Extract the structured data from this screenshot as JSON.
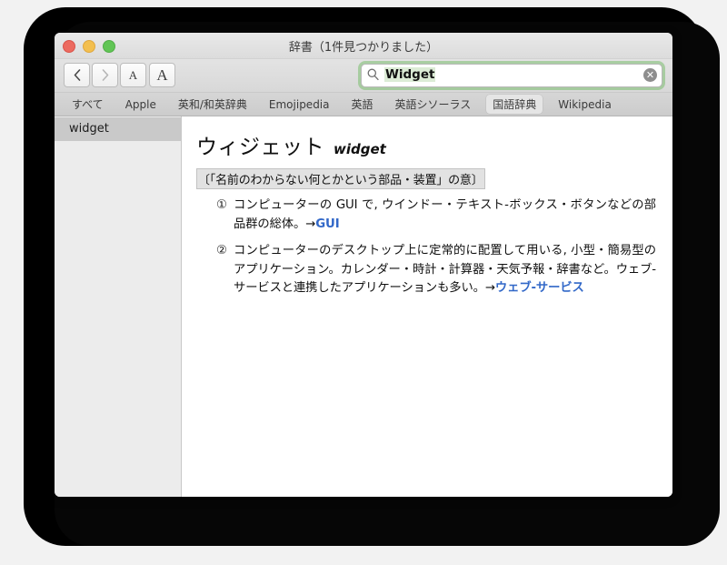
{
  "window": {
    "title": "辞書（1件見つかりました）",
    "traffic_lights": [
      {
        "name": "close",
        "color": "#ec6a5f"
      },
      {
        "name": "minimize",
        "color": "#f3bf4f"
      },
      {
        "name": "zoom",
        "color": "#61c555"
      }
    ]
  },
  "toolbar": {
    "back_label": "‹",
    "forward_label": "›",
    "text_smaller_label": "A",
    "text_larger_label": "A",
    "search": {
      "value": "Widget",
      "placeholder": "検索",
      "icon": "search-icon",
      "clear_icon": "clear-icon",
      "focus_ring_color": "#7abe6e"
    }
  },
  "tabs": [
    {
      "label": "すべて",
      "selected": false
    },
    {
      "label": "Apple",
      "selected": false
    },
    {
      "label": "英和/和英辞典",
      "selected": false
    },
    {
      "label": "Emojipedia",
      "selected": false
    },
    {
      "label": "英語",
      "selected": false
    },
    {
      "label": "英語シソーラス",
      "selected": false
    },
    {
      "label": "国語辞典",
      "selected": true
    },
    {
      "label": "Wikipedia",
      "selected": false
    }
  ],
  "sidebar": {
    "items": [
      {
        "label": "widget",
        "selected": true
      }
    ]
  },
  "entry": {
    "headword": "ウィジェット",
    "romanization": "widget",
    "etymology": "〔「名前のわからない何とかという部品・装置」の意〕",
    "senses": [
      {
        "number": "①",
        "text": "コンピューターの GUI で, ウインドー・テキスト-ボックス・ボタンなどの部品群の総体。→",
        "link": "GUI"
      },
      {
        "number": "②",
        "text": "コンピューターのデスクトップ上に定常的に配置して用いる, 小型・簡易型のアプリケーション。カレンダー・時計・計算器・天気予報・辞書など。ウェブ-サービスと連携したアプリケーションも多い。→",
        "link": "ウェブ-サービス"
      }
    ]
  },
  "colors": {
    "link": "#3268c8",
    "sidebar_selected": "#c9c9c9",
    "search_highlight": "#dcecd6"
  }
}
